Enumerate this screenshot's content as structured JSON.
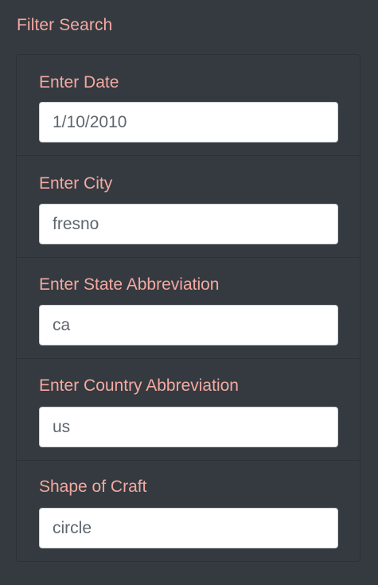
{
  "filter": {
    "title": "Filter Search",
    "fields": [
      {
        "label": "Enter Date",
        "value": "1/10/2010"
      },
      {
        "label": "Enter City",
        "value": "fresno"
      },
      {
        "label": "Enter State Abbreviation",
        "value": "ca"
      },
      {
        "label": "Enter Country Abbreviation",
        "value": "us"
      },
      {
        "label": "Shape of Craft",
        "value": "circle"
      }
    ]
  },
  "colors": {
    "background": "#343a40",
    "label": "#f4a9a1",
    "input_bg": "#ffffff",
    "input_text": "#5f666d"
  }
}
